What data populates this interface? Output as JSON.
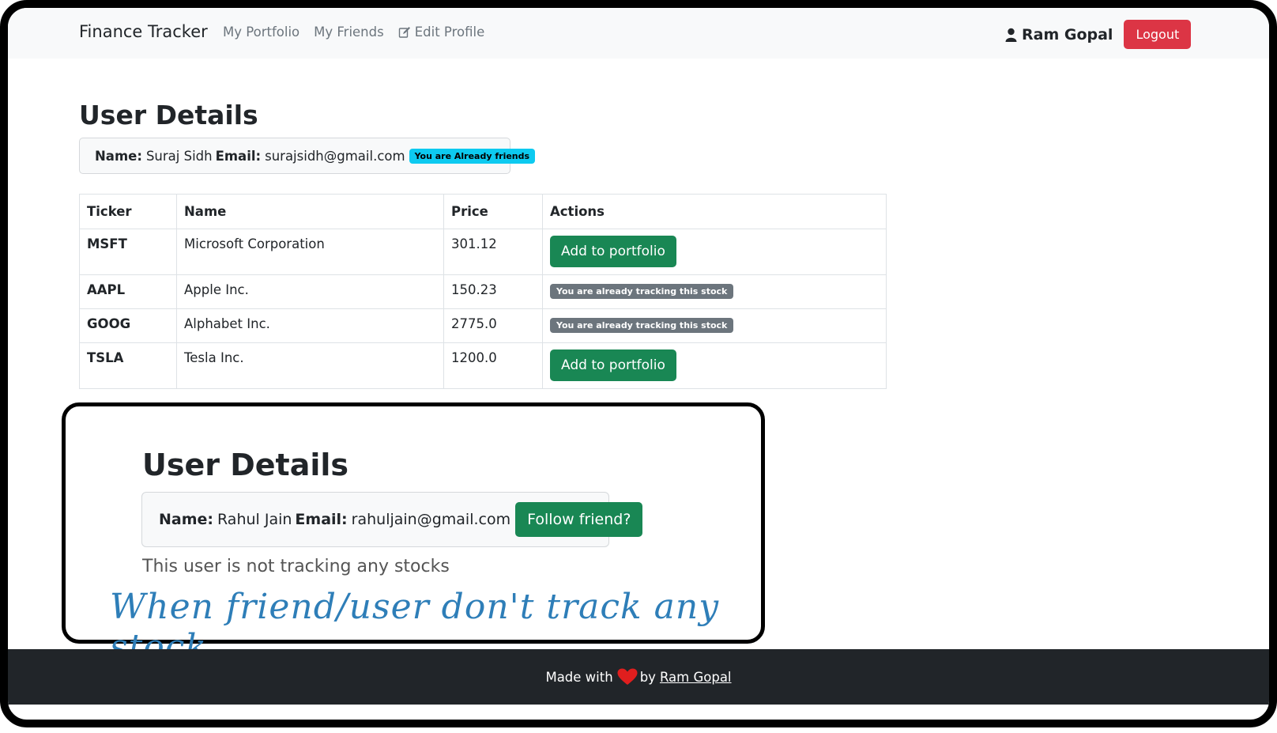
{
  "navbar": {
    "brand": "Finance Tracker",
    "links": [
      {
        "label": "My Portfolio"
      },
      {
        "label": "My Friends"
      },
      {
        "label": "Edit Profile",
        "icon": "edit-icon"
      }
    ],
    "user": {
      "name": "Ram Gopal",
      "icon": "user-icon"
    },
    "logout_label": "Logout",
    "colors": {
      "logout": "#dc3545"
    }
  },
  "main": {
    "title": "User Details",
    "user_card": {
      "name_label": "Name:",
      "name": "Suraj Sidh",
      "email_label": "Email:",
      "email": "surajsidh@gmail.com",
      "badge": "You are Already friends"
    },
    "table": {
      "headers": [
        "Ticker",
        "Name",
        "Price",
        "Actions"
      ],
      "rows": [
        {
          "ticker": "MSFT",
          "name": "Microsoft Corporation",
          "price": "301.12",
          "action": "Add to portfolio"
        },
        {
          "ticker": "AAPL",
          "name": "Apple Inc.",
          "price": "150.23",
          "action": "You are already tracking this stock"
        },
        {
          "ticker": "GOOG",
          "name": "Alphabet Inc.",
          "price": "2775.0",
          "action": "You are already tracking this stock"
        },
        {
          "ticker": "TSLA",
          "name": "Tesla Inc.",
          "price": "1200.0",
          "action": "Add to portfolio"
        }
      ]
    }
  },
  "callout": {
    "title": "User Details",
    "user_card": {
      "name_label": "Name:",
      "name": "Rahul Jain",
      "email_label": "Email:",
      "email": "rahuljain@gmail.com",
      "follow_label": "Follow friend?"
    },
    "empty_message": "This user is not tracking any stocks",
    "annotation": "When friend/user don't track any stock"
  },
  "footer": {
    "prefix": "Made with",
    "heart_icon": "heart-icon",
    "by": "by",
    "author": "Ram Gopal"
  }
}
